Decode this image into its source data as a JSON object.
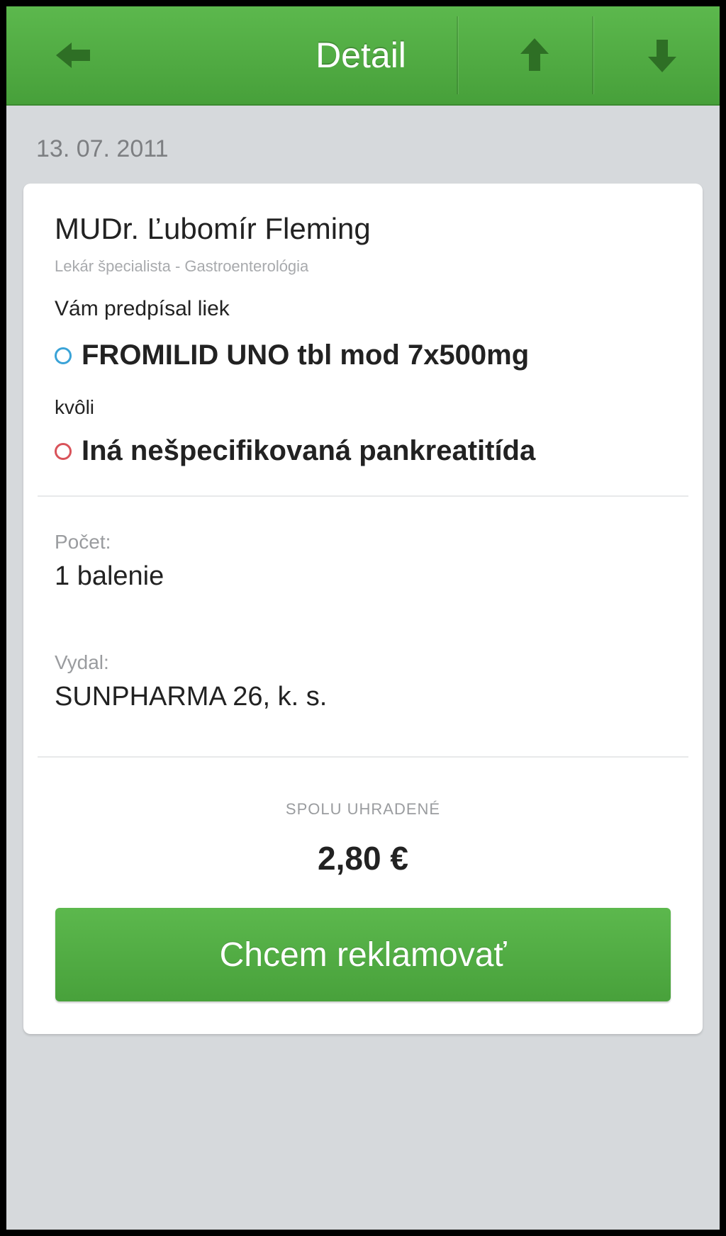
{
  "navbar": {
    "title": "Detail",
    "back_icon": "arrow-left-icon",
    "up_icon": "arrow-up-icon",
    "down_icon": "arrow-down-icon",
    "color": "#4fab42"
  },
  "detail": {
    "date": "13. 07. 2011",
    "doctor_name": "MUDr. Ľubomír Fleming",
    "doctor_specialty": "Lekár špecialista - Gastroenterológia",
    "prescribed_label": "Vám predpísal liek",
    "drug_name": "FROMILID UNO tbl mod 7x500mg",
    "because_label": "kvôli",
    "diagnosis": "Iná nešpecifikovaná pankreatitída",
    "count_label": "Počet:",
    "count_value": "1 balenie",
    "issuer_label": "Vydal:",
    "issuer_value": "SUNPHARMA 26, k. s.",
    "total_label": "SPOLU UHRADENÉ",
    "total_value": "2,80 €",
    "drug_dot_color": "#3aa3d7",
    "diagnosis_dot_color": "#d9535a"
  },
  "actions": {
    "claim_label": "Chcem reklamovať"
  }
}
